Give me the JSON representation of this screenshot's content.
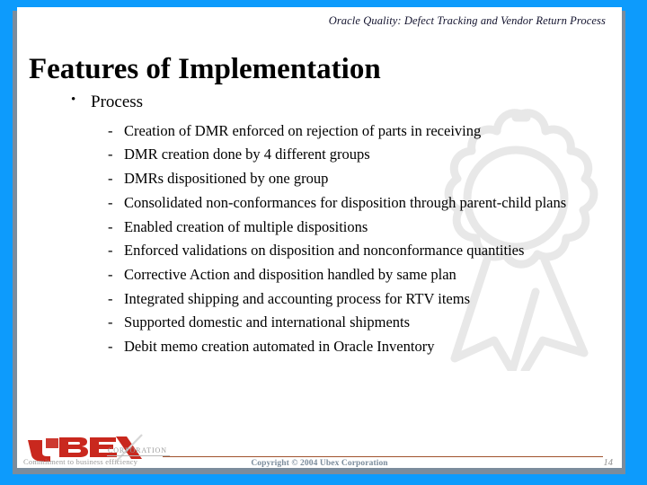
{
  "slide": {
    "header": "Oracle Quality: Defect Tracking and Vendor Return Process",
    "title": "Features of Implementation",
    "bullets": [
      {
        "marker": "•",
        "label": "Process",
        "children": [
          {
            "marker": "-",
            "label": "Creation of DMR enforced on rejection of parts in receiving"
          },
          {
            "marker": "-",
            "label": "DMR creation done by 4 different groups"
          },
          {
            "marker": "-",
            "label": "DMRs dispositioned by one group"
          },
          {
            "marker": "-",
            "label": "Consolidated non-conformances for disposition through parent-child plans"
          },
          {
            "marker": "-",
            "label": "Enabled creation of multiple dispositions"
          },
          {
            "marker": "-",
            "label": "Enforced validations on disposition and nonconformance quantities"
          },
          {
            "marker": "-",
            "label": "Corrective Action and disposition handled by same plan"
          },
          {
            "marker": "-",
            "label": "Integrated shipping and accounting process for RTV items"
          },
          {
            "marker": "-",
            "label": "Supported domestic and international shipments"
          },
          {
            "marker": "-",
            "label": "Debit memo creation automated in Oracle Inventory"
          }
        ]
      }
    ]
  },
  "footer": {
    "copyright": "Copyright © 2004 Ubex Corporation",
    "page_number": "14"
  },
  "logo": {
    "wordmark": "UBEX",
    "corporation": "CORPORATION",
    "tagline": "Commitment to business efficiency"
  },
  "theme": {
    "border_blue": "#0d9bfc",
    "frame_gray": "#7b8c9c",
    "canvas_white": "#ffffff",
    "logo_red": "#c9281e",
    "footer_gray": "#7b8c9c",
    "rule_brown": "#a0522d",
    "watermark_gray": "#e9e9e9"
  }
}
